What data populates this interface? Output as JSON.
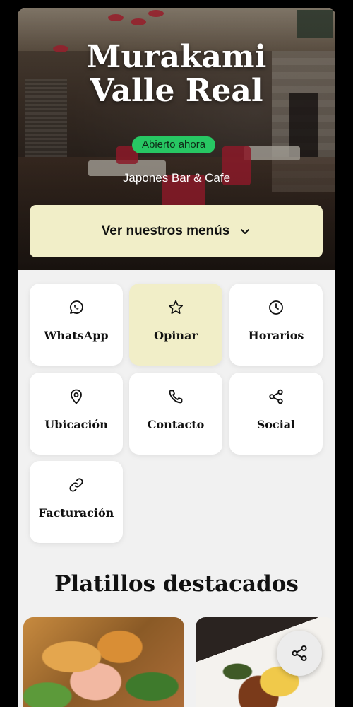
{
  "header": {
    "title_line1": "Murakami",
    "title_line2": "Valle Real",
    "status_badge": "Abierto ahora",
    "subtitle": "Japones Bar & Cafe",
    "menu_button_label": "Ver nuestros menús"
  },
  "actions": [
    {
      "label": "WhatsApp",
      "icon": "whatsapp-icon"
    },
    {
      "label": "Opinar",
      "icon": "star-icon"
    },
    {
      "label": "Horarios",
      "icon": "clock-icon"
    },
    {
      "label": "Ubicación",
      "icon": "location-pin-icon"
    },
    {
      "label": "Contacto",
      "icon": "phone-icon"
    },
    {
      "label": "Social",
      "icon": "share-icon"
    },
    {
      "label": "Facturación",
      "icon": "link-icon"
    }
  ],
  "featured": {
    "title": "Platillos destacados"
  },
  "colors": {
    "accent": "#f1eec8",
    "open_green": "#27c763",
    "background": "#f1f1f1"
  }
}
